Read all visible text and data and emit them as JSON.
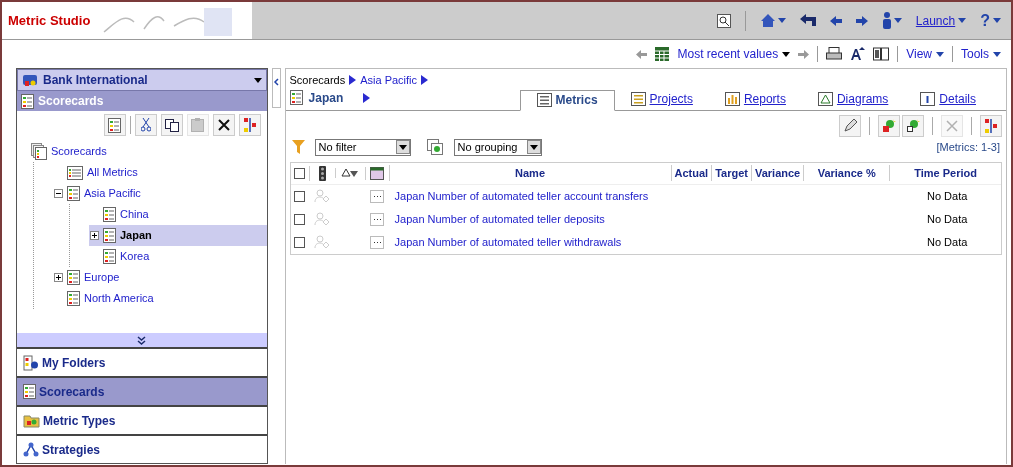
{
  "header": {
    "title": "Metric Studio",
    "launch": "Launch",
    "help": "?"
  },
  "toolbar": {
    "values": "Most recent values",
    "view": "View",
    "tools": "Tools"
  },
  "sidebar": {
    "package": "Bank International",
    "section": "Scorecards",
    "tree": [
      {
        "label": "Scorecards",
        "kind": "root",
        "selected": false,
        "children": [
          {
            "label": "All Metrics",
            "kind": "list",
            "selected": false
          },
          {
            "label": "Asia Pacific",
            "kind": "scorecard",
            "selected": false,
            "expanded": true,
            "children": [
              {
                "label": "China",
                "kind": "scorecard",
                "selected": false
              },
              {
                "label": "Japan",
                "kind": "scorecard",
                "selected": true,
                "expanded": false
              },
              {
                "label": "Korea",
                "kind": "scorecard",
                "selected": false
              }
            ]
          },
          {
            "label": "Europe",
            "kind": "scorecard",
            "selected": false,
            "expanded": false
          },
          {
            "label": "North America",
            "kind": "scorecard",
            "selected": false
          }
        ]
      }
    ],
    "nav": [
      {
        "label": "My Folders",
        "kind": "folders",
        "selected": false
      },
      {
        "label": "Scorecards",
        "kind": "scorecards",
        "selected": true
      },
      {
        "label": "Metric Types",
        "kind": "types",
        "selected": false
      },
      {
        "label": "Strategies",
        "kind": "strategies",
        "selected": false
      }
    ]
  },
  "main": {
    "breadcrumb": [
      "Scorecards",
      "Asia Pacific"
    ],
    "title": "Japan",
    "tabs": [
      {
        "label": "Metrics",
        "kind": "metrics",
        "selected": true
      },
      {
        "label": "Projects",
        "kind": "projects",
        "selected": false
      },
      {
        "label": "Reports",
        "kind": "reports",
        "selected": false
      },
      {
        "label": "Diagrams",
        "kind": "diagrams",
        "selected": false
      },
      {
        "label": "Details",
        "kind": "details",
        "selected": false
      }
    ],
    "select_all_checked": false,
    "filter": "No filter",
    "grouping": "No grouping",
    "count": "[Metrics: 1-3]",
    "columns": [
      "Name",
      "Actual",
      "Target",
      "Variance",
      "Variance %",
      "Time Period"
    ],
    "rows": [
      {
        "name": "Japan Number of automated teller account transfers",
        "time_period": "No Data",
        "checked": false
      },
      {
        "name": "Japan Number of automated teller deposits",
        "time_period": "No Data",
        "checked": false
      },
      {
        "name": "Japan Number of automated teller withdrawals",
        "time_period": "No Data",
        "checked": false
      }
    ]
  }
}
